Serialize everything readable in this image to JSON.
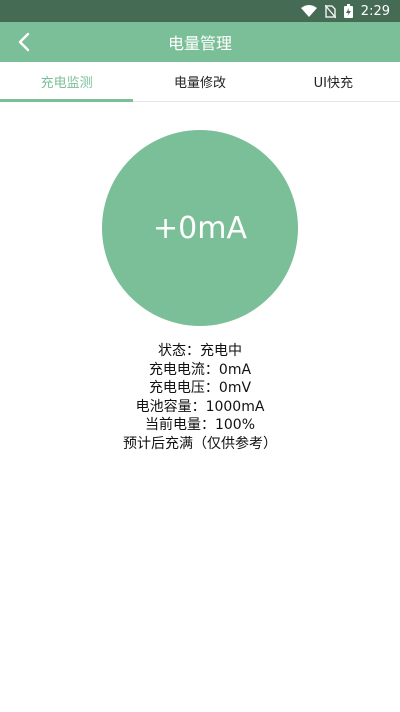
{
  "status_bar": {
    "time": "2:29",
    "icons": [
      "wifi-icon",
      "no-sim-icon",
      "battery-charging-icon"
    ]
  },
  "app_bar": {
    "title": "电量管理",
    "back_icon": "chevron-left-icon"
  },
  "tabs": [
    {
      "label": "充电监测",
      "active": true
    },
    {
      "label": "电量修改",
      "active": false
    },
    {
      "label": "UI快充",
      "active": false
    }
  ],
  "current_display": "+0mA",
  "info": {
    "status": "状态：充电中",
    "charge_current": "充电电流：0mA",
    "charge_voltage": "充电电压：0mV",
    "battery_capacity": "电池容量：1000mA",
    "current_level": "当前电量：100%",
    "estimate": "预计后充满（仅供参考）"
  },
  "colors": {
    "accent": "#7bbf99",
    "status_bar": "#466b54"
  }
}
